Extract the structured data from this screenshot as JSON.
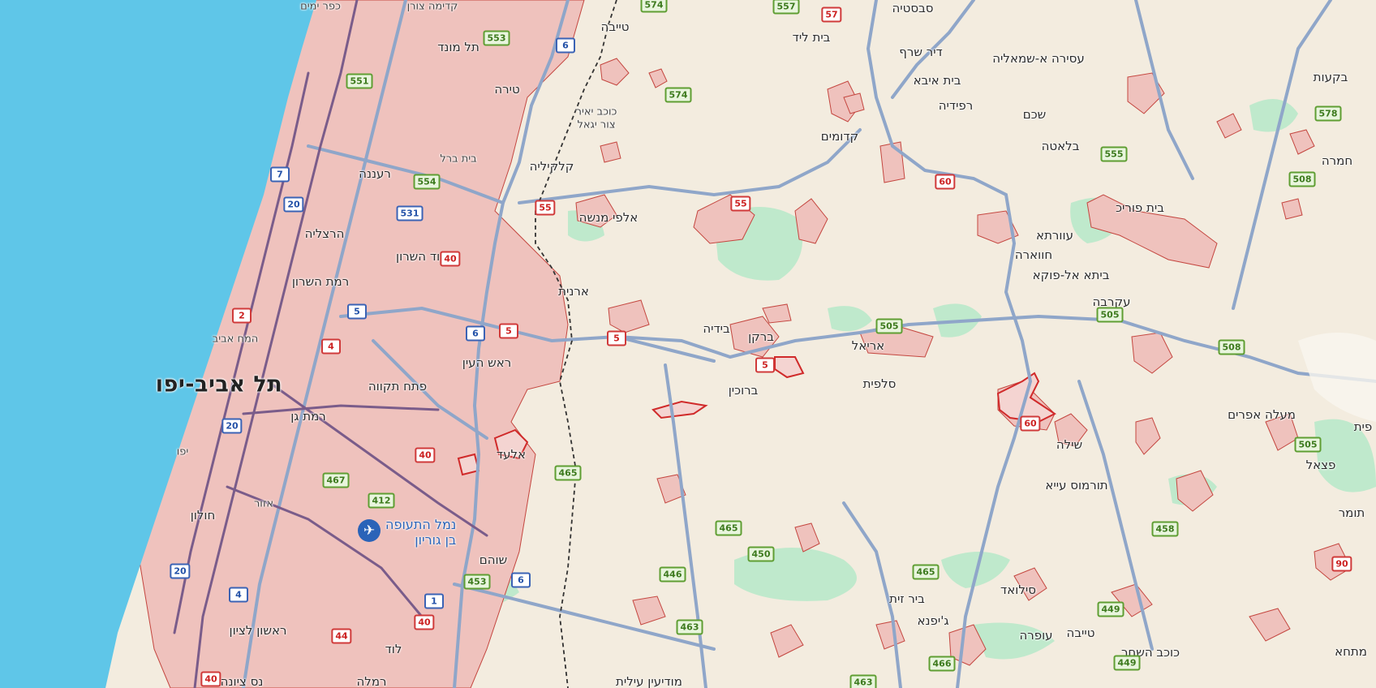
{
  "colors": {
    "sea": "#5fc6e8",
    "land": "#f3ecdf",
    "settlement_fill": "#efc2bd",
    "settlement_stroke": "#c4463f",
    "park": "#bfe9cc",
    "road": "#8fa6c9",
    "highway": "#7a5c8a"
  },
  "icons": {
    "airport": "airport-icon"
  },
  "places": [
    {
      "name": "כפר ימים",
      "style": "small"
    },
    {
      "name": "קדימה צורן",
      "style": "small"
    },
    {
      "name": "טייבה",
      "style": "normal"
    },
    {
      "name": "תל מונד",
      "style": "normal"
    },
    {
      "name": "טירה",
      "style": "normal"
    },
    {
      "name": "כוכב יאיר",
      "style": "small"
    },
    {
      "name": "צור יגאל",
      "style": "small"
    },
    {
      "name": "בית ברל",
      "style": "small"
    },
    {
      "name": "רעננה",
      "style": "normal"
    },
    {
      "name": "קלקיליה",
      "style": "normal"
    },
    {
      "name": "הרצליה",
      "style": "normal"
    },
    {
      "name": "אלפי מנשה",
      "style": "normal"
    },
    {
      "name": "הוד השרון",
      "style": "normal"
    },
    {
      "name": "רמת השרון",
      "style": "normal"
    },
    {
      "name": "ארנית",
      "style": "normal"
    },
    {
      "name": "המח אביב",
      "style": "small"
    },
    {
      "name": "תל אביב-יפו",
      "style": "big"
    },
    {
      "name": "פתח תקווה",
      "style": "normal"
    },
    {
      "name": "ראש העין",
      "style": "normal"
    },
    {
      "name": "רמת גן",
      "style": "normal"
    },
    {
      "name": "יפו",
      "style": "small"
    },
    {
      "name": "אלעד",
      "style": "normal"
    },
    {
      "name": "אזור",
      "style": "small"
    },
    {
      "name": "חולון",
      "style": "normal"
    },
    {
      "name": "שוהם",
      "style": "normal"
    },
    {
      "name": "ראשון לציון",
      "style": "normal"
    },
    {
      "name": "לוד",
      "style": "normal"
    },
    {
      "name": "נס ציונה",
      "style": "normal"
    },
    {
      "name": "רמלה",
      "style": "normal"
    },
    {
      "name": "מודיעין עילית",
      "style": "normal"
    },
    {
      "name": "בית ליד",
      "style": "normal"
    },
    {
      "name": "סבסטיה",
      "style": "normal"
    },
    {
      "name": "דיר שרף",
      "style": "normal"
    },
    {
      "name": "עסירה א-שמאליה",
      "style": "normal"
    },
    {
      "name": "בית איבא",
      "style": "normal"
    },
    {
      "name": "רפידיה",
      "style": "normal"
    },
    {
      "name": "שכם",
      "style": "normal"
    },
    {
      "name": "קדומים",
      "style": "normal"
    },
    {
      "name": "בלאטה",
      "style": "normal"
    },
    {
      "name": "בקעות",
      "style": "normal"
    },
    {
      "name": "חמרה",
      "style": "normal"
    },
    {
      "name": "בית פוריכ",
      "style": "normal"
    },
    {
      "name": "עוורתא",
      "style": "normal"
    },
    {
      "name": "חווארה",
      "style": "normal"
    },
    {
      "name": "ביתא אל-פוקא",
      "style": "normal"
    },
    {
      "name": "עקרבה",
      "style": "normal"
    },
    {
      "name": "בידיה",
      "style": "normal"
    },
    {
      "name": "ברקן",
      "style": "normal"
    },
    {
      "name": "אריאל",
      "style": "normal"
    },
    {
      "name": "ברוכין",
      "style": "normal"
    },
    {
      "name": "סלפית",
      "style": "normal"
    },
    {
      "name": "מעלה אפרים",
      "style": "normal"
    },
    {
      "name": "פצאל",
      "style": "normal"
    },
    {
      "name": "שילה",
      "style": "normal"
    },
    {
      "name": "תורמוס עייא",
      "style": "normal"
    },
    {
      "name": "תומר",
      "style": "normal"
    },
    {
      "name": "סילואד",
      "style": "normal"
    },
    {
      "name": "ביר זית",
      "style": "normal"
    },
    {
      "name": "ג'יפנא",
      "style": "normal"
    },
    {
      "name": "עופרה",
      "style": "normal"
    },
    {
      "name": "טייבה",
      "style": "normal"
    },
    {
      "name": "כוכב השחר",
      "style": "normal"
    },
    {
      "name": "מתחא",
      "style": "normal"
    },
    {
      "name": "פית",
      "style": "normal"
    }
  ],
  "airport": {
    "line1": "נמל התעופה",
    "line2": "בן גוריון"
  },
  "route_shields": [
    {
      "number": "574",
      "type": "green"
    },
    {
      "number": "557",
      "type": "green"
    },
    {
      "number": "57",
      "type": "red"
    },
    {
      "number": "553",
      "type": "green"
    },
    {
      "number": "6",
      "type": "blue"
    },
    {
      "number": "551",
      "type": "green"
    },
    {
      "number": "574",
      "type": "green"
    },
    {
      "number": "554",
      "type": "green"
    },
    {
      "number": "531",
      "type": "blue"
    },
    {
      "number": "55",
      "type": "red"
    },
    {
      "number": "55",
      "type": "red"
    },
    {
      "number": "7",
      "type": "blue"
    },
    {
      "number": "20",
      "type": "blue"
    },
    {
      "number": "40",
      "type": "red"
    },
    {
      "number": "2",
      "type": "red"
    },
    {
      "number": "5",
      "type": "blue"
    },
    {
      "number": "6",
      "type": "blue"
    },
    {
      "number": "5",
      "type": "red"
    },
    {
      "number": "4",
      "type": "red"
    },
    {
      "number": "5",
      "type": "red"
    },
    {
      "number": "5",
      "type": "red"
    },
    {
      "number": "20",
      "type": "blue"
    },
    {
      "number": "40",
      "type": "red"
    },
    {
      "number": "467",
      "type": "green"
    },
    {
      "number": "412",
      "type": "green"
    },
    {
      "number": "465",
      "type": "green"
    },
    {
      "number": "20",
      "type": "blue"
    },
    {
      "number": "4",
      "type": "blue"
    },
    {
      "number": "453",
      "type": "green"
    },
    {
      "number": "6",
      "type": "blue"
    },
    {
      "number": "1",
      "type": "blue"
    },
    {
      "number": "44",
      "type": "red"
    },
    {
      "number": "40",
      "type": "red"
    },
    {
      "number": "40",
      "type": "red"
    },
    {
      "number": "60",
      "type": "red"
    },
    {
      "number": "555",
      "type": "green"
    },
    {
      "number": "578",
      "type": "green"
    },
    {
      "number": "508",
      "type": "green"
    },
    {
      "number": "505",
      "type": "green"
    },
    {
      "number": "505",
      "type": "green"
    },
    {
      "number": "508",
      "type": "green"
    },
    {
      "number": "60",
      "type": "red"
    },
    {
      "number": "505",
      "type": "green"
    },
    {
      "number": "465",
      "type": "green"
    },
    {
      "number": "450",
      "type": "green"
    },
    {
      "number": "446",
      "type": "green"
    },
    {
      "number": "465",
      "type": "green"
    },
    {
      "number": "458",
      "type": "green"
    },
    {
      "number": "90",
      "type": "red"
    },
    {
      "number": "463",
      "type": "green"
    },
    {
      "number": "449",
      "type": "green"
    },
    {
      "number": "449",
      "type": "green"
    },
    {
      "number": "466",
      "type": "green"
    },
    {
      "number": "463",
      "type": "green"
    }
  ]
}
